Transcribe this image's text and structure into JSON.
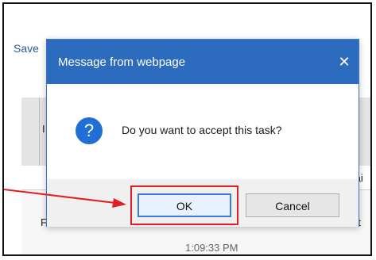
{
  "background": {
    "save_label": "Save",
    "header_letter": "I",
    "row_text_1": "tai",
    "row_text_2": "nt",
    "left_letter": "F",
    "time_text": "1:09:33 PM"
  },
  "dialog": {
    "title": "Message from webpage",
    "close_glyph": "✕",
    "icon_glyph": "?",
    "message": "Do you want to accept this task?",
    "ok_label": "OK",
    "cancel_label": "Cancel"
  },
  "colors": {
    "titlebar": "#2d6bbf",
    "highlight": "#e02020",
    "icon": "#1f6fd6"
  }
}
